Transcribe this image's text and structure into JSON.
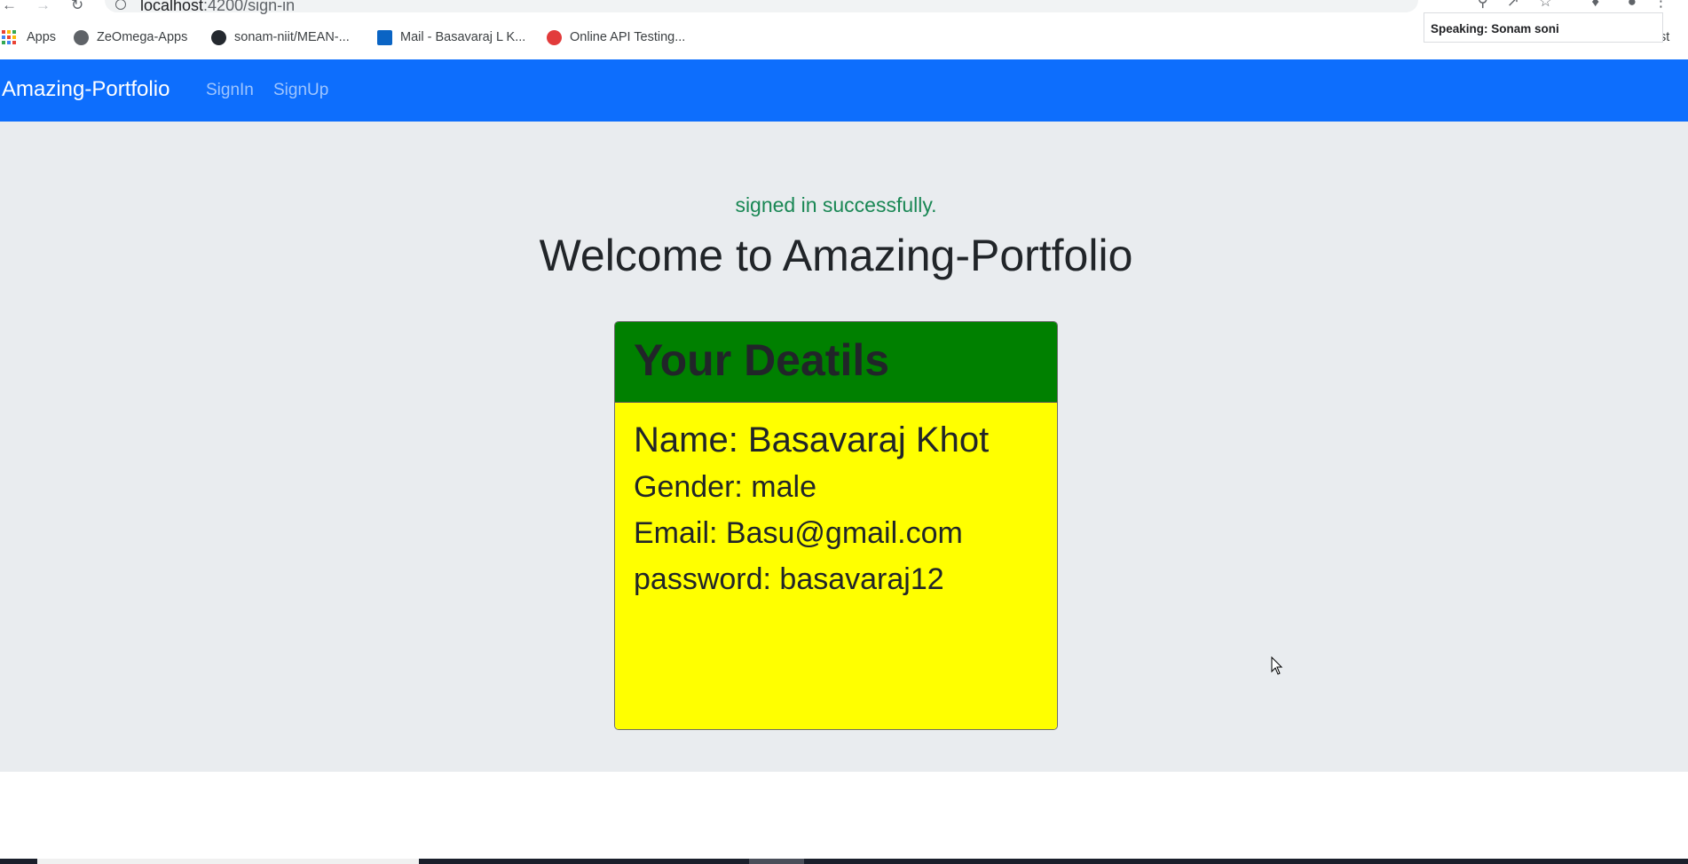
{
  "browser": {
    "url_host": "localhost",
    "url_path": ":4200/sign-in",
    "bookmarks": [
      {
        "label": "Apps"
      },
      {
        "label": "ZeOmega-Apps"
      },
      {
        "label": "sonam-niit/MEAN-..."
      },
      {
        "label": "Mail - Basavaraj L K..."
      },
      {
        "label": "Online API Testing..."
      }
    ],
    "tooltip": "Speaking: Sonam soni",
    "trailing_fragment": "st"
  },
  "navbar": {
    "brand": "Amazing-Portfolio",
    "links": [
      {
        "label": "SignIn"
      },
      {
        "label": "SignUp"
      }
    ],
    "color": "#0d6efd"
  },
  "main": {
    "success_message": "signed in successfully.",
    "welcome": "Welcome to Amazing-Portfolio",
    "card": {
      "title": "Your Deatils",
      "header_color": "#008000",
      "body_color": "#ffff00",
      "name": "Name: Basavaraj Khot",
      "gender": "Gender: male",
      "email": "Email: Basu@gmail.com",
      "password": "password: basavaraj12"
    }
  }
}
